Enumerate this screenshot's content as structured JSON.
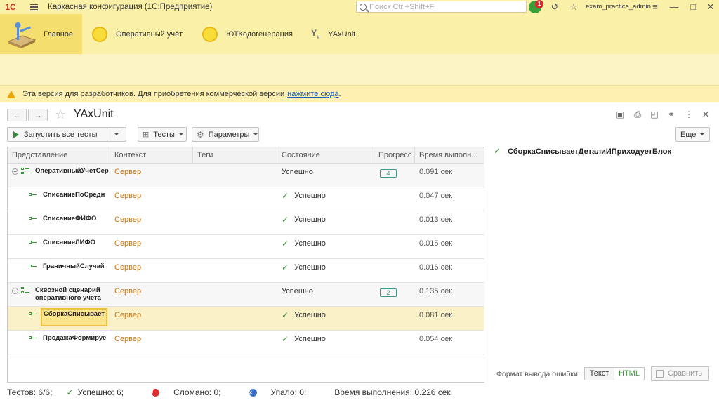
{
  "app": {
    "logo_text": "1С",
    "title": "Каркасная конфигурация  (1С:Предприятие)",
    "search_placeholder": "Поиск Ctrl+Shift+F",
    "notification_count": "1",
    "user": "exam_practice_admin"
  },
  "sections": [
    {
      "label": "Главное",
      "icon": "home-icon",
      "active": true
    },
    {
      "label": "Оперативный учёт",
      "icon": "sun-icon"
    },
    {
      "label": "ЮТКодогенерация",
      "icon": "sun-icon"
    },
    {
      "label": "YAxUnit",
      "icon": "yaxunit-icon"
    }
  ],
  "notice": {
    "text": "Эта версия для разработчиков. Для приобретения коммерческой версии",
    "link": "нажмите сюда",
    "tail": "."
  },
  "form": {
    "title": "YAxUnit"
  },
  "toolbar": {
    "run_all": "Запустить все тесты",
    "tests": "Тесты",
    "params": "Параметры",
    "more": "Еще"
  },
  "grid": {
    "columns": [
      "Представление",
      "Контекст",
      "Теги",
      "Состояние",
      "Прогресс",
      "Время выполн..."
    ],
    "rows": [
      {
        "level": 0,
        "name": "ОперативныйУчетСер",
        "context": "Сервер",
        "state": "Успешно",
        "progress": "4",
        "time": "0.091 сек"
      },
      {
        "level": 1,
        "name": "СписаниеПоСредн",
        "context": "Сервер",
        "state": "Успешно",
        "time": "0.047 сек"
      },
      {
        "level": 1,
        "name": "СписаниеФИФО",
        "context": "Сервер",
        "state": "Успешно",
        "time": "0.013 сек"
      },
      {
        "level": 1,
        "name": "СписаниеЛИФО",
        "context": "Сервер",
        "state": "Успешно",
        "time": "0.015 сек"
      },
      {
        "level": 1,
        "name": "ГраничныйСлучай",
        "context": "Сервер",
        "state": "Успешно",
        "time": "0.016 сек"
      },
      {
        "level": 0,
        "name": "Сквозной сценарий\nоперативного учета",
        "context": "Сервер",
        "state": "Успешно",
        "progress": "2",
        "time": "0.135 сек"
      },
      {
        "level": 1,
        "name": "СборкаСписывает",
        "context": "Сервер",
        "state": "Успешно",
        "time": "0.081 сек",
        "selected": true
      },
      {
        "level": 1,
        "name": "ПродажаФормируе",
        "context": "Сервер",
        "state": "Успешно",
        "time": "0.054 сек"
      }
    ]
  },
  "details": {
    "title": "СборкаСписываетДеталиИПриходуетБлок",
    "format_label": "Формат вывода ошибки:",
    "format_text": "Текст",
    "format_html": "HTML",
    "compare": "Сравнить"
  },
  "status": {
    "tests": "Тестов: 6/6;",
    "success": "Успешно: 6;",
    "broken": "Сломано: 0;",
    "failed": "Упало: 0;",
    "duration": "Время выполнения: 0.226 сек"
  },
  "colors": {
    "header_bg": "#fbf0a8",
    "active_section": "#f4df6e",
    "context_text": "#c0771e",
    "success_green": "#3a9a3a",
    "selected_row": "#fbf1c8"
  }
}
